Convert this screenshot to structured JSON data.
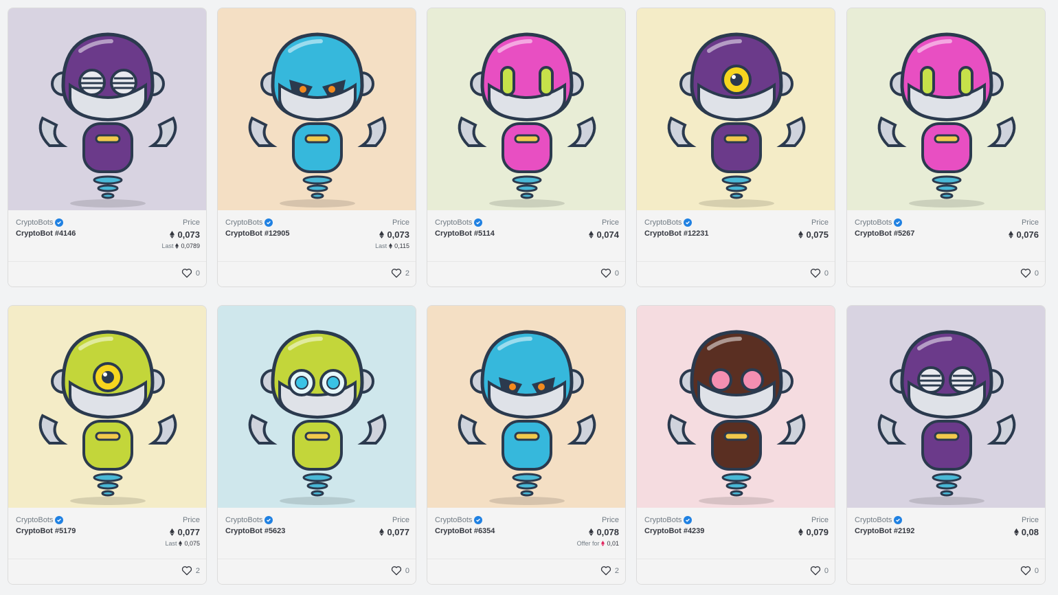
{
  "cards": [
    {
      "collection": "CryptoBots",
      "name": "CryptoBot #4146",
      "price_label": "Price",
      "price": "0,073",
      "sub_label": "Last",
      "sub_value": "0,0789",
      "likes": "0",
      "bg": "#d8d3e1",
      "head": "#6b3a8a",
      "eyes": "visor"
    },
    {
      "collection": "CryptoBots",
      "name": "CryptoBot #12905",
      "price_label": "Price",
      "price": "0,073",
      "sub_label": "Last",
      "sub_value": "0,115",
      "likes": "2",
      "bg": "#f4dfc4",
      "head": "#36b8dc",
      "eyes": "angry"
    },
    {
      "collection": "CryptoBots",
      "name": "CryptoBot #5114",
      "price_label": "Price",
      "price": "0,074",
      "sub_label": "",
      "sub_value": "",
      "likes": "0",
      "bg": "#e8edd6",
      "head": "#e84fc2",
      "eyes": "pills"
    },
    {
      "collection": "CryptoBots",
      "name": "CryptoBot #12231",
      "price_label": "Price",
      "price": "0,075",
      "sub_label": "",
      "sub_value": "",
      "likes": "0",
      "bg": "#f4ecc7",
      "head": "#6b3a8a",
      "eyes": "cyclops"
    },
    {
      "collection": "CryptoBots",
      "name": "CryptoBot #5267",
      "price_label": "Price",
      "price": "0,076",
      "sub_label": "",
      "sub_value": "",
      "likes": "0",
      "bg": "#e8edd6",
      "head": "#e84fc2",
      "eyes": "pills"
    },
    {
      "collection": "CryptoBots",
      "name": "CryptoBot #5179",
      "price_label": "Price",
      "price": "0,077",
      "sub_label": "Last",
      "sub_value": "0,075",
      "likes": "2",
      "bg": "#f4ecc7",
      "head": "#c3d63a",
      "eyes": "cyclops"
    },
    {
      "collection": "CryptoBots",
      "name": "CryptoBot #5623",
      "price_label": "Price",
      "price": "0,077",
      "sub_label": "",
      "sub_value": "",
      "likes": "0",
      "bg": "#cfe7ec",
      "head": "#c3d63a",
      "eyes": "goggles"
    },
    {
      "collection": "CryptoBots",
      "name": "CryptoBot #6354",
      "price_label": "Price",
      "price": "0,078",
      "sub_label": "Offer for",
      "sub_value": "0,01",
      "likes": "2",
      "bg": "#f4dfc4",
      "head": "#36b8dc",
      "eyes": "angry"
    },
    {
      "collection": "CryptoBots",
      "name": "CryptoBot #4239",
      "price_label": "Price",
      "price": "0,079",
      "sub_label": "",
      "sub_value": "",
      "likes": "0",
      "bg": "#f5dce0",
      "head": "#5a2f22",
      "eyes": "pink"
    },
    {
      "collection": "CryptoBots",
      "name": "CryptoBot #2192",
      "price_label": "Price",
      "price": "0,08",
      "sub_label": "",
      "sub_value": "",
      "likes": "0",
      "bg": "#d8d3e1",
      "head": "#6b3a8a",
      "eyes": "visor"
    }
  ],
  "colors": {
    "verified": "#2081e2",
    "text": "#353840",
    "muted": "#707a83",
    "offer_eth": "#e0245e"
  },
  "icons": {
    "eth": "ethereum-icon",
    "heart": "heart-icon",
    "verified": "verified-badge-icon"
  }
}
